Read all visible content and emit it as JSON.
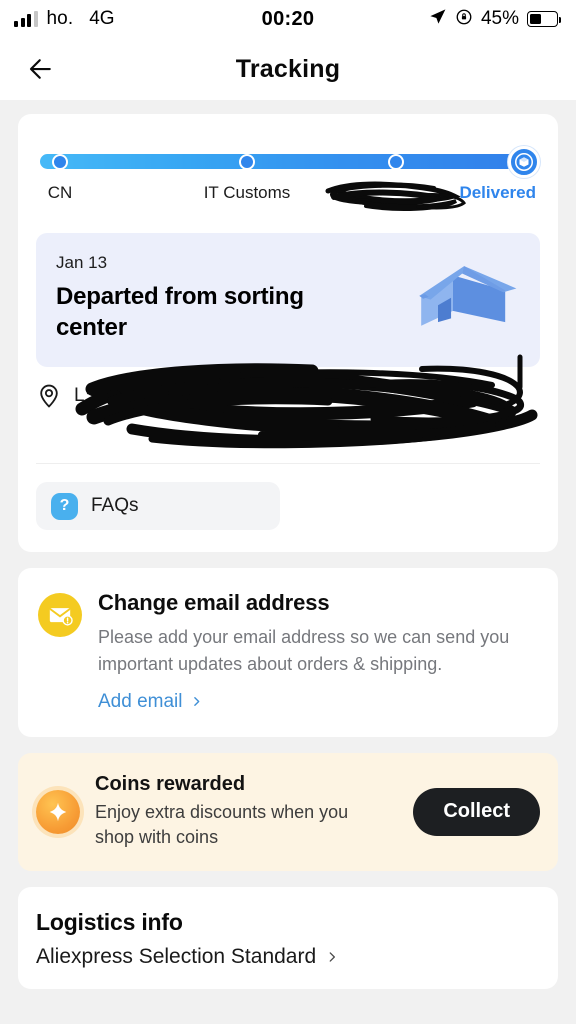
{
  "status_bar": {
    "carrier": "ho.",
    "network": "4G",
    "time": "00:20",
    "battery_percent": "45%",
    "battery_level": 45,
    "icons": [
      "signal-bars-icon",
      "location-arrow-icon",
      "rotation-lock-icon",
      "battery-icon"
    ]
  },
  "nav": {
    "title": "Tracking",
    "back_icon": "arrow-left-icon"
  },
  "tracking": {
    "steps": [
      {
        "label": "CN",
        "state": "done"
      },
      {
        "label": "IT Customs",
        "state": "done"
      },
      {
        "label": "",
        "state": "redacted"
      },
      {
        "label": "Delivered",
        "state": "current"
      }
    ],
    "accent_color": "#2f85ec",
    "bar_start_color": "#46b9f7",
    "bar_end_color": "#3180ea",
    "final_icon": "package-box-icon",
    "banner": {
      "date": "Jan 13",
      "title": "Departed from sorting center",
      "background": "#eceffb",
      "illustration": "house-icon"
    },
    "address": {
      "pin_icon": "location-pin-icon",
      "text": "L**********e",
      "redacted": true
    },
    "faq": {
      "icon": "question-mark-icon",
      "label": "FAQs"
    }
  },
  "email_card": {
    "icon": "envelope-alert-icon",
    "title": "Change email address",
    "description": "Please add your email address so we can send you important updates about orders & shipping.",
    "link_label": "Add email",
    "link_icon": "chevron-right-icon",
    "link_color": "#3f8fd6",
    "icon_color": "#f4cb21"
  },
  "coins_card": {
    "icon": "sparkle-coin-icon",
    "title": "Coins rewarded",
    "description": "Enjoy extra discounts when you shop with coins",
    "button_label": "Collect",
    "background": "#fdf4e3",
    "button_color": "#1d1f22"
  },
  "logistics": {
    "title": "Logistics info",
    "carrier": "Aliexpress Selection Standard",
    "chevron_icon": "chevron-right-icon"
  }
}
